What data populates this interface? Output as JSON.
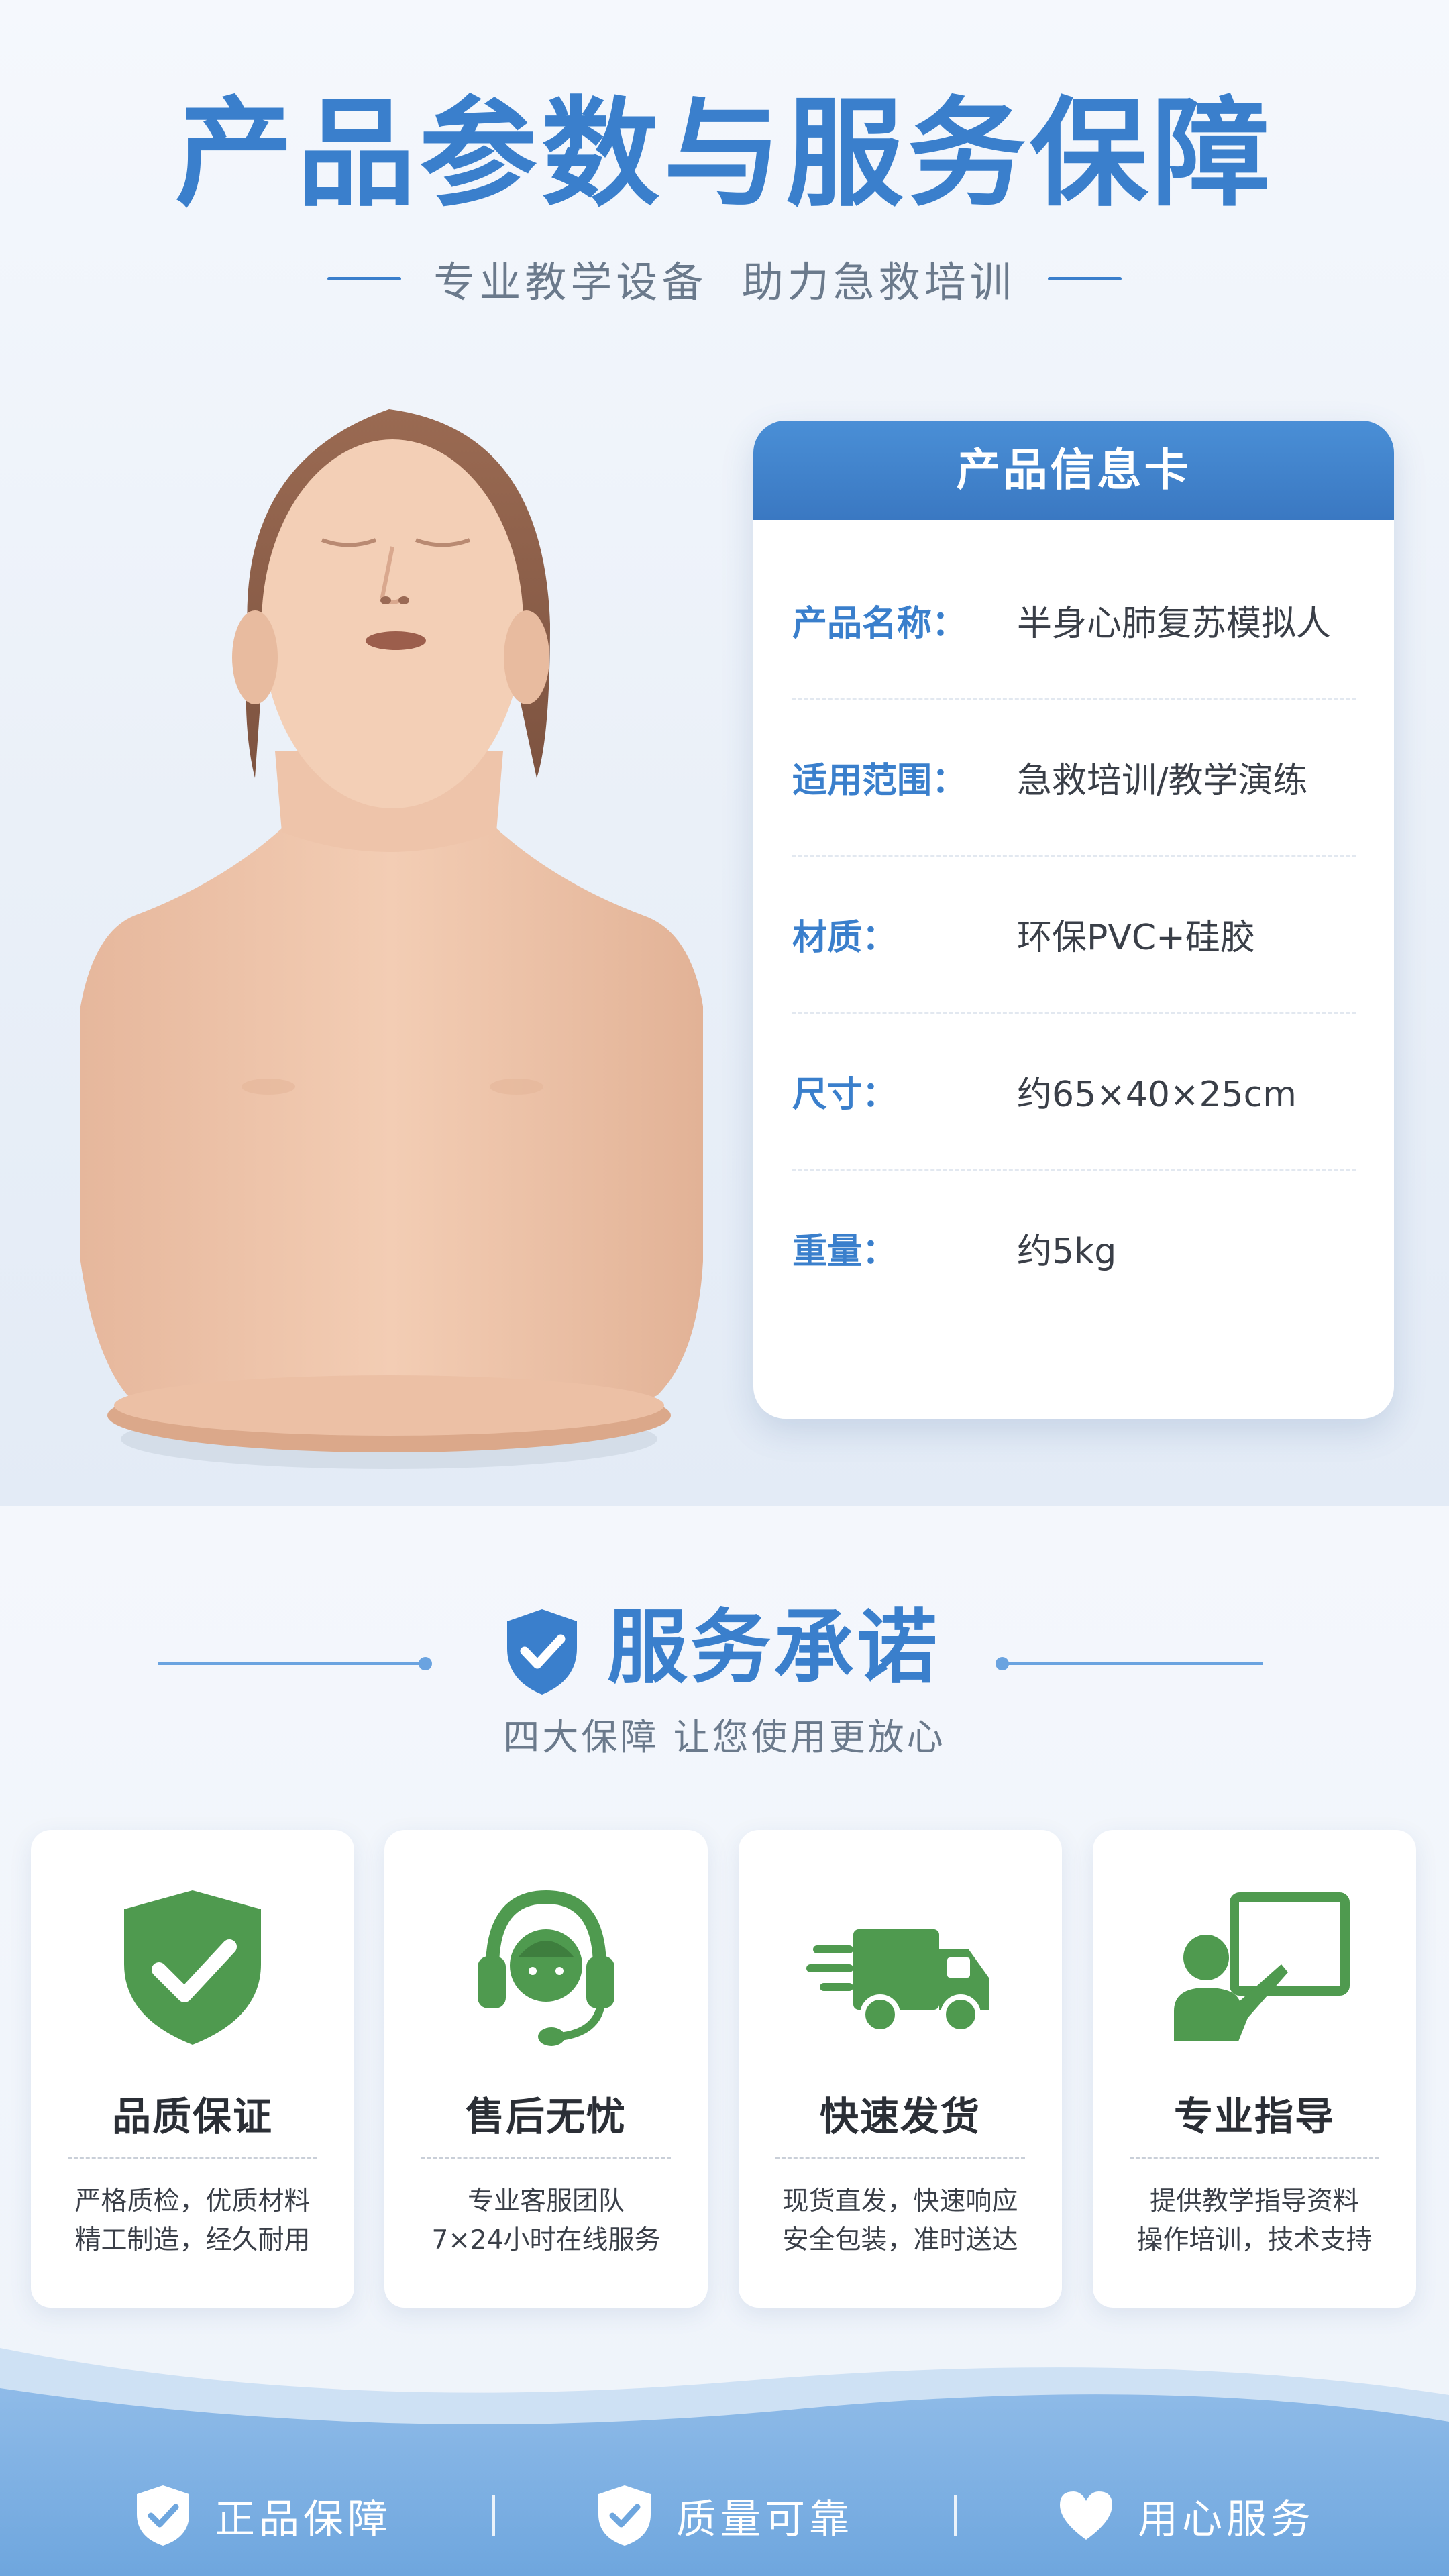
{
  "header": {
    "title": "产品参数与服务保障",
    "subtitle": "专业教学设备  助力急救培训"
  },
  "info_card": {
    "title": "产品信息卡",
    "rows": [
      {
        "label": "产品名称：",
        "value": "半身心肺复苏模拟人"
      },
      {
        "label": "适用范围：",
        "value": "急救培训/教学演练"
      },
      {
        "label": "材质：",
        "value": "环保PVC+硅胶"
      },
      {
        "label": "尺寸：",
        "value": "约65×40×25cm"
      },
      {
        "label": "重量：",
        "value": "约5kg"
      }
    ]
  },
  "service": {
    "title": "服务承诺",
    "subtitle": "四大保障 让您使用更放心",
    "features": [
      {
        "icon": "shield-check-icon",
        "title": "品质保证",
        "desc_line1": "严格质检，优质材料",
        "desc_line2": "精工制造，经久耐用"
      },
      {
        "icon": "headset-icon",
        "title": "售后无忧",
        "desc_line1": "专业客服团队",
        "desc_line2": "7×24小时在线服务"
      },
      {
        "icon": "delivery-truck-icon",
        "title": "快速发货",
        "desc_line1": "现货直发，快速响应",
        "desc_line2": "安全包装，准时送达"
      },
      {
        "icon": "teacher-board-icon",
        "title": "专业指导",
        "desc_line1": "提供教学指导资料",
        "desc_line2": "操作培训，技术支持"
      }
    ]
  },
  "footer": {
    "items": [
      {
        "icon": "shield-check-icon",
        "label": "正品保障"
      },
      {
        "icon": "shield-check-icon",
        "label": "质量可靠"
      },
      {
        "icon": "heart-icon",
        "label": "用心服务"
      }
    ],
    "separator": "|"
  },
  "colors": {
    "primary_blue": "#3a7fcc",
    "feature_green": "#4f9a4f",
    "text_dark": "#2b2f36",
    "text_gray": "#6b7a8c"
  }
}
